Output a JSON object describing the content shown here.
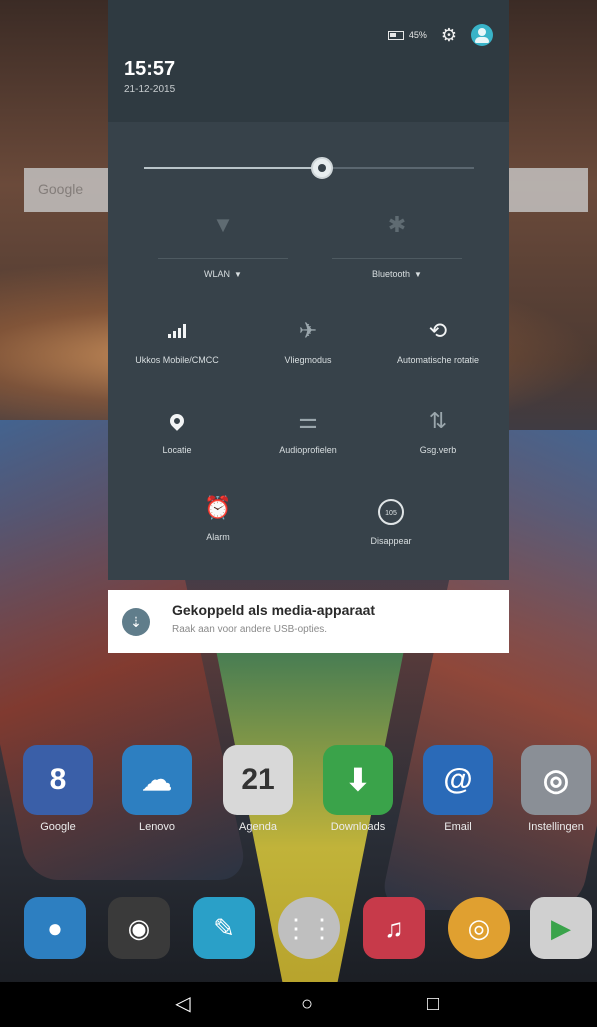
{
  "status": {
    "time": "15:57",
    "date": "21-12-2015",
    "battery": "45%",
    "icons": [
      "battery-icon",
      "gear-icon",
      "user-icon"
    ]
  },
  "quick_settings": {
    "brightness": 0.54,
    "wifi": {
      "label": "WLAN",
      "icon": "wifi-icon"
    },
    "bluetooth": {
      "label": "Bluetooth",
      "icon": "bluetooth-icon"
    },
    "tiles": [
      {
        "label": "Ukkos Mobile/CMCC",
        "icon": "signal-icon"
      },
      {
        "label": "Vliegmodus",
        "icon": "airplane-icon"
      },
      {
        "label": "Automatische rotatie",
        "icon": "rotate-icon"
      },
      {
        "label": "Locatie",
        "icon": "location-icon"
      },
      {
        "label": "Audioprofielen",
        "icon": "audio-profile-icon"
      },
      {
        "label": "Gsg.verb",
        "icon": "data-icon"
      },
      {
        "label": "Alarm",
        "icon": "alarm-icon"
      },
      {
        "label": "Disappear",
        "icon": "disappear-icon",
        "badge": "105"
      }
    ]
  },
  "notification": {
    "title": "Gekoppeld als media-apparaat",
    "subtitle": "Raak aan voor andere USB-opties.",
    "icon": "usb-icon"
  },
  "home_apps": [
    {
      "name": "Google",
      "glyph": "8",
      "color": "#3a5fa8"
    },
    {
      "name": "Lenovo",
      "glyph": "☁",
      "color": "#2d7fc1"
    },
    {
      "name": "Agenda",
      "glyph": "21",
      "color": "#d8d8d8"
    },
    {
      "name": "Downloads",
      "glyph": "⬇",
      "color": "#3aa34a"
    },
    {
      "name": "Email",
      "glyph": "@",
      "color": "#2a6ab8"
    },
    {
      "name": "Instellingen",
      "glyph": "◎",
      "color": "#8a8f96"
    }
  ],
  "dock": [
    {
      "name": "contacts",
      "color": "#2d7fc1"
    },
    {
      "name": "camera",
      "color": "#3a3a3a"
    },
    {
      "name": "notes",
      "color": "#2aa0c8"
    },
    {
      "name": "all-apps",
      "color": "#bfbfbf"
    },
    {
      "name": "music",
      "color": "#c73a4a"
    },
    {
      "name": "chrome",
      "color": "#e0a030"
    },
    {
      "name": "play-store",
      "color": "#d0d0d0"
    }
  ],
  "navbar": {
    "back": "◁",
    "home": "○",
    "recents": "□"
  },
  "wallpaper": {
    "search_hint": "Google"
  }
}
